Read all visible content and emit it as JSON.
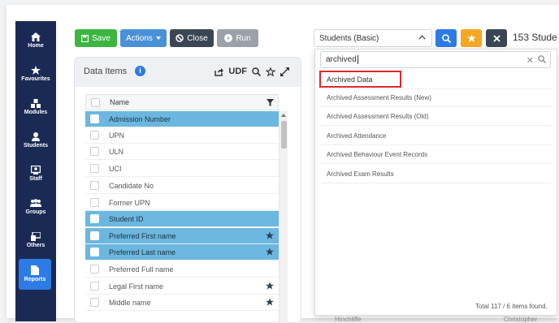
{
  "sidebar": {
    "items": [
      {
        "label": "Home",
        "icon": "home-icon"
      },
      {
        "label": "Favourites",
        "icon": "star-icon"
      },
      {
        "label": "Modules",
        "icon": "modules-icon"
      },
      {
        "label": "Students",
        "icon": "user-icon"
      },
      {
        "label": "Staff",
        "icon": "staff-icon"
      },
      {
        "label": "Groups",
        "icon": "groups-icon"
      },
      {
        "label": "Others",
        "icon": "others-icon"
      },
      {
        "label": "Reports",
        "icon": "reports-icon",
        "active": true
      }
    ]
  },
  "toolbar": {
    "save_label": "Save",
    "actions_label": "Actions",
    "close_label": "Close",
    "run_label": "Run"
  },
  "data_items": {
    "title": "Data Items",
    "udf_label": "UDF",
    "column_header": "Name",
    "rows": [
      {
        "label": "Admission Number",
        "selected": true,
        "starred": false
      },
      {
        "label": "UPN",
        "selected": false,
        "starred": false
      },
      {
        "label": "ULN",
        "selected": false,
        "starred": false
      },
      {
        "label": "UCI",
        "selected": false,
        "starred": false
      },
      {
        "label": "Candidate No",
        "selected": false,
        "starred": false
      },
      {
        "label": "Former UPN",
        "selected": false,
        "starred": false
      },
      {
        "label": "Student ID",
        "selected": true,
        "starred": false
      },
      {
        "label": "Preferred First name",
        "selected": true,
        "starred": true
      },
      {
        "label": "Preferred Last name",
        "selected": true,
        "starred": true
      },
      {
        "label": "Preferred Full name",
        "selected": false,
        "starred": false
      },
      {
        "label": "Legal First name",
        "selected": false,
        "starred": true
      },
      {
        "label": "Middle name",
        "selected": false,
        "starred": true
      }
    ]
  },
  "right": {
    "select_value": "Students (Basic)",
    "count_text": "153 Stude"
  },
  "dropdown": {
    "search_value": "archived",
    "items": [
      "Archived Data",
      "Archived Assessment Results (New)",
      "Archived Assessment Results (Old)",
      "Archived Attendance",
      "Archived Behaviour Event Records",
      "Archived Exam Results"
    ],
    "footer": "Total 117 / 6 items found.",
    "bg_left": "Hinchliffe",
    "bg_right": "Christopher"
  },
  "colors": {
    "sidebar": "#1b2a55",
    "accent": "#2d7be5",
    "save": "#3db541",
    "selected_row": "#6bb7df",
    "highlight_border": "#e0282e"
  }
}
